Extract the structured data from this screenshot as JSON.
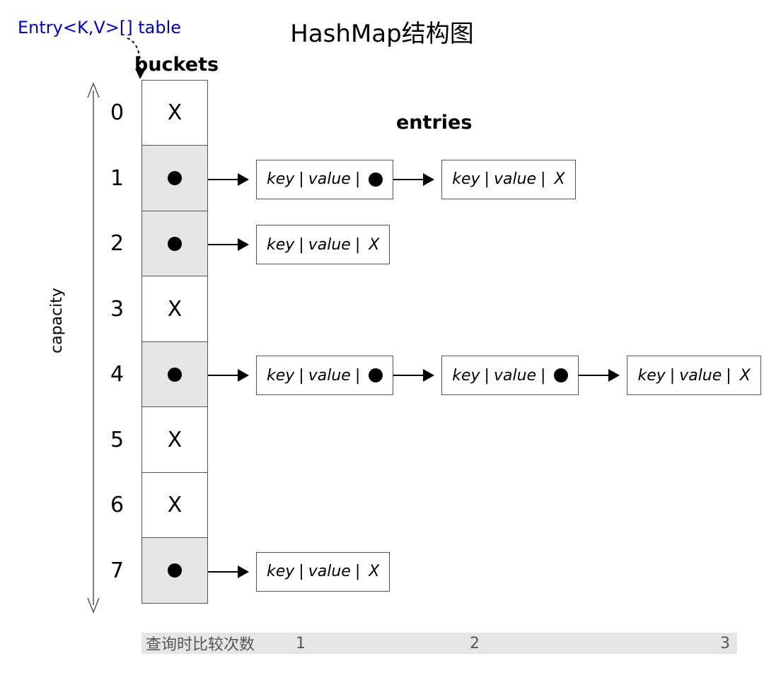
{
  "title": "HashMap结构图",
  "table_label": "Entry<K,V>[] table",
  "buckets_label": "buckets",
  "entries_label": "entries",
  "capacity_label": "capacity",
  "null_symbol": "X",
  "entry_text": {
    "key": "key",
    "value": "value"
  },
  "buckets": [
    {
      "index": "0",
      "has_entry": false,
      "chain": []
    },
    {
      "index": "1",
      "has_entry": true,
      "chain": [
        {
          "next": true
        },
        {
          "next": false
        }
      ]
    },
    {
      "index": "2",
      "has_entry": true,
      "chain": [
        {
          "next": false
        }
      ]
    },
    {
      "index": "3",
      "has_entry": false,
      "chain": []
    },
    {
      "index": "4",
      "has_entry": true,
      "chain": [
        {
          "next": true
        },
        {
          "next": true
        },
        {
          "next": false
        }
      ]
    },
    {
      "index": "5",
      "has_entry": false,
      "chain": []
    },
    {
      "index": "6",
      "has_entry": false,
      "chain": []
    },
    {
      "index": "7",
      "has_entry": true,
      "chain": [
        {
          "next": false
        }
      ]
    }
  ],
  "footer": {
    "label": "查询时比较次数",
    "numbers": [
      "1",
      "2",
      "3"
    ]
  }
}
